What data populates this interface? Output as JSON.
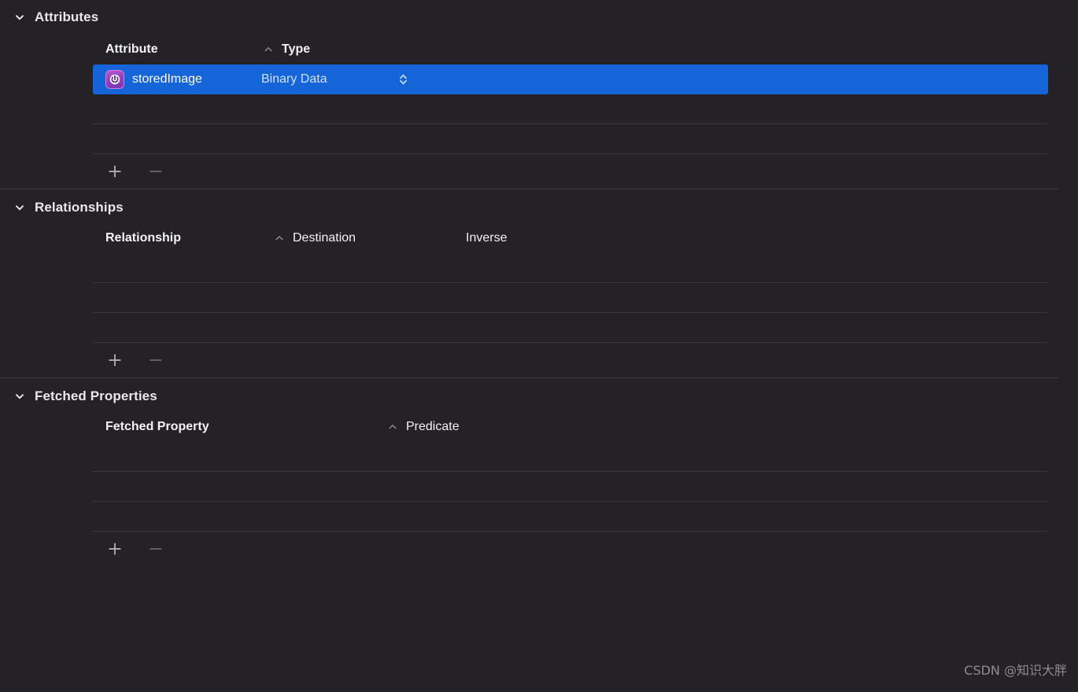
{
  "theme": {
    "background": "#242226",
    "selection_blue": "#1564d8",
    "divider": "#413e43",
    "row_line": "#3a373c",
    "text_primary": "#e9e7ea",
    "text_dim": "#8e8b91",
    "icon_purple": "#a84fcc"
  },
  "sections": [
    {
      "title": "Attributes",
      "disclosure_icon": "chevron-down-icon",
      "columns": [
        {
          "label": "Attribute",
          "sorted": true,
          "sort_icon": "chevron-up-icon"
        },
        {
          "label": "Type",
          "sorted": false
        }
      ],
      "rows": [
        {
          "icon": "attribute-power-icon",
          "name": "storedImage",
          "type": "Binary Data",
          "type_popup_icon": "chevron-up-down-icon",
          "selected": true
        }
      ],
      "empty_rows": 2,
      "footer": {
        "add_label": "+",
        "add_icon": "plus-icon",
        "remove_label": "–",
        "remove_icon": "minus-icon",
        "remove_disabled": true
      }
    },
    {
      "title": "Relationships",
      "disclosure_icon": "chevron-down-icon",
      "columns": [
        {
          "label": "Relationship",
          "sorted": true,
          "sort_icon": "chevron-up-icon"
        },
        {
          "label": "Destination",
          "sorted": false
        },
        {
          "label": "Inverse",
          "sorted": false
        }
      ],
      "rows": [],
      "empty_rows": 3,
      "footer": {
        "add_label": "+",
        "add_icon": "plus-icon",
        "remove_label": "–",
        "remove_icon": "minus-icon",
        "remove_disabled": true
      }
    },
    {
      "title": "Fetched Properties",
      "disclosure_icon": "chevron-down-icon",
      "columns": [
        {
          "label": "Fetched Property",
          "sorted": true,
          "sort_icon": "chevron-up-icon"
        },
        {
          "label": "Predicate",
          "sorted": false
        }
      ],
      "rows": [],
      "empty_rows": 3,
      "footer": {
        "add_label": "+",
        "add_icon": "plus-icon",
        "remove_label": "–",
        "remove_icon": "minus-icon",
        "remove_disabled": true
      }
    }
  ],
  "watermark": "CSDN @知识大胖"
}
